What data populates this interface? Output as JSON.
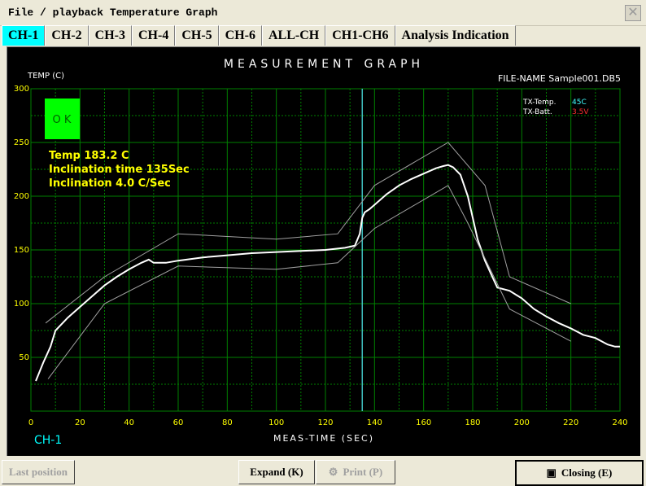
{
  "window": {
    "title": "File / playback Temperature Graph",
    "close_glyph": "✕"
  },
  "tabs": [
    "CH-1",
    "CH-2",
    "CH-3",
    "CH-4",
    "CH-5",
    "CH-6",
    "ALL-CH",
    "CH1-CH6",
    "Analysis Indication"
  ],
  "active_tab": 0,
  "graph": {
    "title": "MEASUREMENT GRAPH",
    "file_name": "FILE-NAME  Sample001.DB5",
    "tx_temp_label": "TX-Temp.",
    "tx_temp_value": "45C",
    "tx_batt_label": "TX-Batt.",
    "tx_batt_value": "3.5V",
    "ok_label": "O K",
    "info_temp": "Temp 183.2  C",
    "info_time": "Inclination time 135Sec",
    "info_incl": "Inclination 4.0  C/Sec",
    "channel_label": "CH-1",
    "colors": {
      "measured": "#ffffff",
      "envelope": "#a0a0a0",
      "grid": "#008000",
      "cursor": "#40c0c0",
      "ok_bg": "#00ff00",
      "labels": "#ffff00",
      "tx_temp": "#40ffff",
      "tx_batt": "#ff3030"
    }
  },
  "chart_data": {
    "type": "line",
    "xlabel": "MEAS-TIME (SEC)",
    "ylabel": "TEMP (C)",
    "xlim": [
      0,
      240
    ],
    "ylim": [
      0,
      300
    ],
    "xticks": [
      0,
      20,
      40,
      60,
      80,
      100,
      120,
      140,
      160,
      180,
      200,
      220,
      240
    ],
    "yticks": [
      50,
      100,
      150,
      200,
      250,
      300
    ],
    "grid": true,
    "cursor_x": 135,
    "series": [
      {
        "x": [
          2,
          5,
          8,
          10,
          15,
          20,
          25,
          30,
          35,
          40,
          45,
          48,
          50,
          55,
          60,
          70,
          80,
          90,
          100,
          110,
          120,
          128,
          132,
          134,
          135,
          136,
          138,
          140,
          145,
          150,
          155,
          160,
          165,
          168,
          170,
          172,
          175,
          178,
          180,
          182,
          185,
          188,
          190,
          195,
          200,
          205,
          210,
          215,
          220,
          225,
          230,
          235,
          238,
          240
        ],
        "y": [
          28,
          45,
          60,
          75,
          87,
          97,
          107,
          117,
          125,
          132,
          138,
          141,
          138,
          138,
          140,
          143,
          145,
          147,
          148,
          149,
          150,
          152,
          154,
          165,
          180,
          185,
          188,
          192,
          202,
          210,
          216,
          221,
          226,
          228,
          229,
          227,
          220,
          200,
          180,
          160,
          140,
          125,
          115,
          112,
          105,
          95,
          88,
          82,
          77,
          71,
          68,
          62,
          60,
          60
        ]
      },
      {
        "x": [
          6,
          30,
          60,
          100,
          125,
          140,
          170,
          185,
          195,
          220
        ],
        "y": [
          82,
          125,
          165,
          160,
          165,
          210,
          250,
          210,
          125,
          100
        ]
      },
      {
        "x": [
          7,
          30,
          60,
          100,
          125,
          140,
          170,
          178,
          195,
          220
        ],
        "y": [
          30,
          100,
          135,
          132,
          138,
          170,
          210,
          175,
          95,
          65
        ]
      }
    ]
  },
  "buttons": {
    "last_position": "Last position",
    "expand": "Expand (K)",
    "print": "Print (P)",
    "closing": "Closing (E)"
  }
}
